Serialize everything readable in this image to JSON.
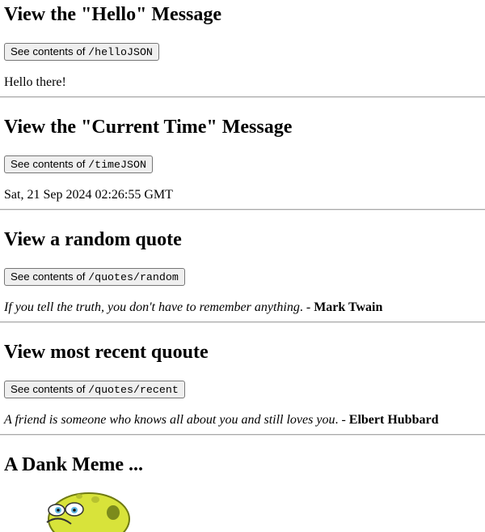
{
  "sections": [
    {
      "title": "View the \"Hello\" Message",
      "button_prefix": "See contents of ",
      "button_path": "/helloJSON",
      "output": "Hello there!"
    },
    {
      "title": "View the \"Current Time\" Message",
      "button_prefix": "See contents of ",
      "button_path": "/timeJSON",
      "output": "Sat, 21 Sep 2024 02:26:55 GMT"
    },
    {
      "title": "View a random quote",
      "button_prefix": "See contents of ",
      "button_path": "/quotes/random",
      "quote": "If you tell the truth, you don't have to remember anything",
      "separator": ". - ",
      "author": "Mark Twain"
    },
    {
      "title": "View most recent quoute",
      "button_prefix": "See contents of ",
      "button_path": "/quotes/recent",
      "quote": "A friend is someone who knows all about you and still loves you",
      "separator": ". - ",
      "author": "Elbert Hubbard"
    }
  ],
  "meme": {
    "title": "A Dank Meme ...",
    "image": "spongebob-meme-image"
  },
  "colors": {
    "divider": "#a9a9a9",
    "button_bg": "#efefef",
    "button_border": "#767676",
    "meme_yellow": "#d8e33a"
  }
}
